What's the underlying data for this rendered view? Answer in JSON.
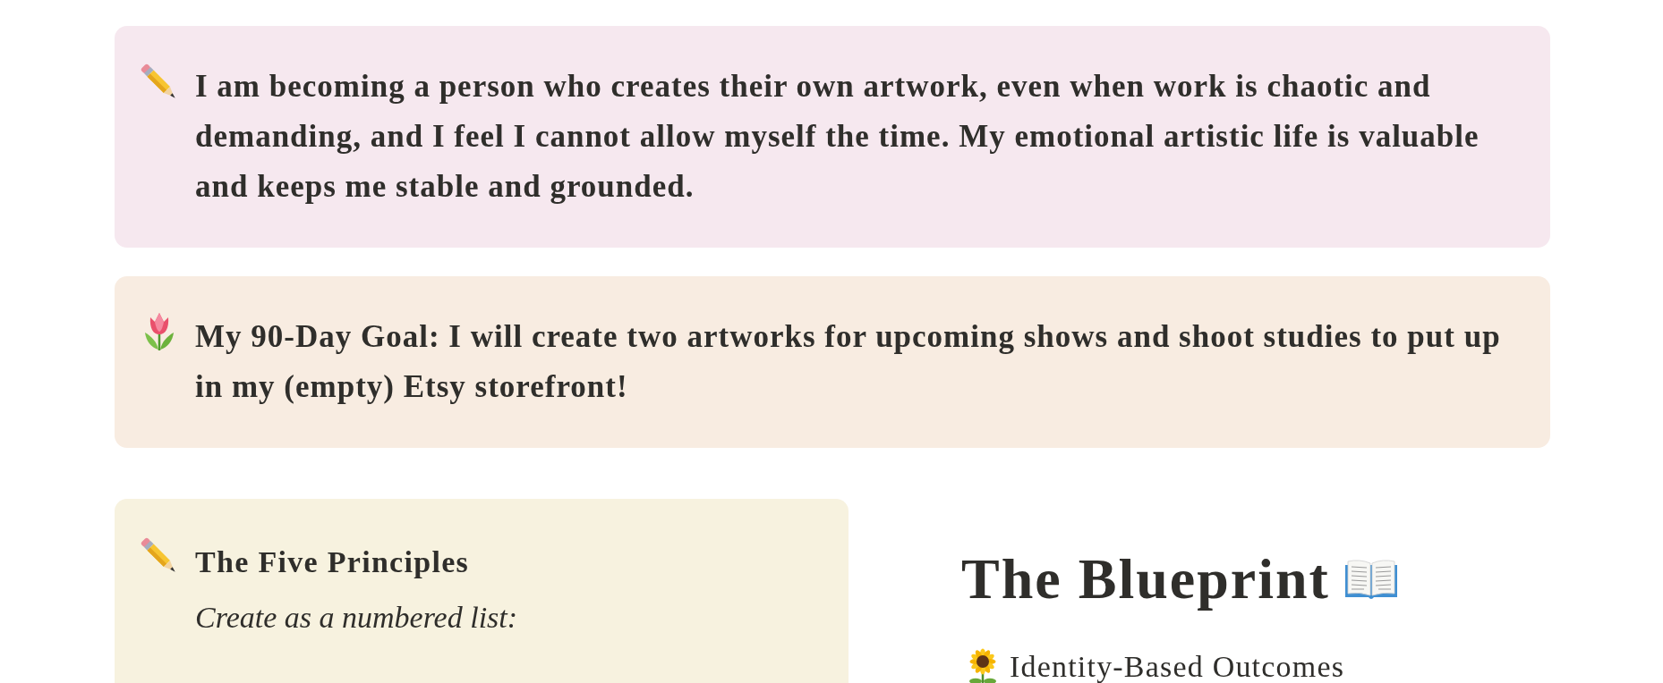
{
  "callouts": [
    {
      "text": "I am becoming a person who creates their own artwork, even when work is chaotic and demanding, and I feel I cannot allow myself the time. My emotional artistic life is valuable and keeps me stable and grounded."
    },
    {
      "text": "My 90-Day Goal: I will create two artworks for upcoming shows and shoot studies to put up in my (empty) Etsy storefront!"
    }
  ],
  "principles": {
    "title": "The Five Principles",
    "instruction": "Create as a numbered list:"
  },
  "blueprint": {
    "title": "The Blueprint",
    "items": [
      {
        "label": "Identity-Based Outcomes"
      }
    ]
  }
}
